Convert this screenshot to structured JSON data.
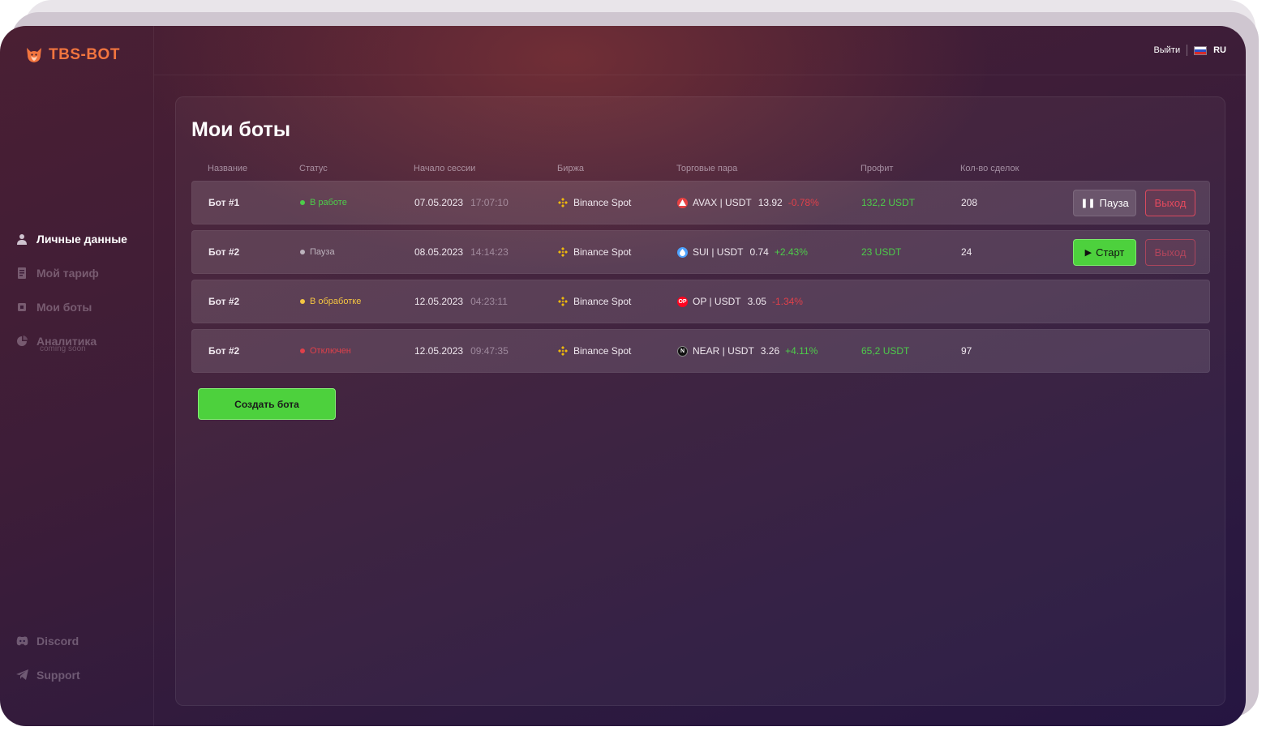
{
  "app": {
    "name": "TBS-BOT"
  },
  "sidebar": {
    "items": [
      {
        "label": "Личные данные",
        "icon": "user-icon"
      },
      {
        "label": "Мой тариф",
        "icon": "receipt-icon"
      },
      {
        "label": "Мои боты",
        "icon": "chip-icon"
      },
      {
        "label": "Аналитика",
        "icon": "pie-chart-icon",
        "sub": "coming soon"
      }
    ],
    "bottom": [
      {
        "label": "Discord",
        "icon": "discord-icon"
      },
      {
        "label": "Support",
        "icon": "telegram-icon"
      }
    ]
  },
  "header": {
    "logout": "Выйти",
    "lang": "RU"
  },
  "page": {
    "title": "Мои боты",
    "columns": [
      "Название",
      "Статус",
      "Начало сессии",
      "Биржа",
      "Торговые пара",
      "Профит",
      "Кол-во сделок"
    ],
    "rows": [
      {
        "name": "Бот #1",
        "status": "В работе",
        "status_color": "#4dcc4a",
        "date": "07.05.2023",
        "time": "17:07:10",
        "exchange": "Binance Spot",
        "pair": "AVAX | USDT",
        "coin_color": "#e84142",
        "price": "13.92",
        "change": "-0.78%",
        "change_dir": "neg",
        "profit": "132,2 USDT",
        "deals": "208",
        "action": "Пауза",
        "action_type": "pause",
        "exit": "Выход"
      },
      {
        "name": "Бот #2",
        "status": "Пауза",
        "status_color": "#bdb3bd",
        "date": "08.05.2023",
        "time": "14:14:23",
        "exchange": "Binance Spot",
        "pair": "SUI | USDT",
        "coin_color": "#4da2ff",
        "price": "0.74",
        "change": "+2.43%",
        "change_dir": "pos",
        "profit": "23 USDT",
        "deals": "24",
        "action": "Старт",
        "action_type": "start",
        "exit": "Выход"
      },
      {
        "name": "Бот #2",
        "status": "В обработке",
        "status_color": "#f5c542",
        "date": "12.05.2023",
        "time": "04:23:11",
        "exchange": "Binance Spot",
        "pair": "OP | USDT",
        "coin_color": "#ff0420",
        "coin_text": "OP",
        "price": "3.05",
        "change": "-1.34%",
        "change_dir": "neg",
        "profit": "",
        "deals": ""
      },
      {
        "name": "Бот #2",
        "status": "Отключен",
        "status_color": "#e0404a",
        "date": "12.05.2023",
        "time": "09:47:35",
        "exchange": "Binance Spot",
        "pair": "NEAR | USDT",
        "coin_color": "#111111",
        "coin_text": "N",
        "price": "3.26",
        "change": "+4.11%",
        "change_dir": "pos",
        "profit": "65,2 USDT",
        "deals": "97"
      }
    ],
    "create_button": "Создать бота"
  },
  "colors": {
    "accent_green": "#4dd13d",
    "logo_orange": "#f2753f",
    "danger": "#e44a5e",
    "binance_yellow": "#f0b90b"
  }
}
